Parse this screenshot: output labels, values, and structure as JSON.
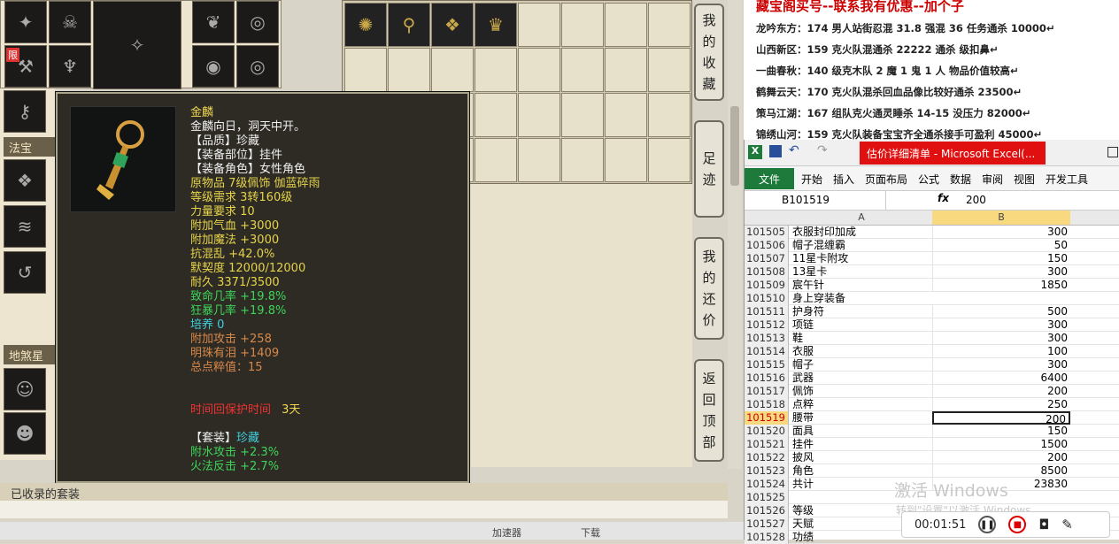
{
  "inventory": {
    "limit_badge": "限"
  },
  "sections": {
    "fabao": "法宝",
    "disha": "地煞星",
    "collected": "已收录的套装"
  },
  "tooltip": {
    "name": "金麟",
    "desc": "金麟向日，洞天中开。",
    "lines": [
      {
        "text": "【品质】珍藏",
        "color": "#f0f0f0"
      },
      {
        "text": "【装备部位】挂件",
        "color": "#f0f0f0"
      },
      {
        "text": "【装备角色】女性角色",
        "color": "#f0f0f0"
      },
      {
        "text": "原物品 7级佩饰 伽蓝碎雨",
        "color": "#e6d34a"
      },
      {
        "text": "等级需求 3转160级",
        "color": "#e6d34a"
      },
      {
        "text": "力量要求 10",
        "color": "#e6d34a"
      },
      {
        "text": "附加气血 +3000",
        "color": "#e6d34a"
      },
      {
        "text": "附加魔法 +3000",
        "color": "#e6d34a"
      },
      {
        "text": "抗混乱 +42.0%",
        "color": "#e6d34a"
      },
      {
        "text": "默契度 12000/12000",
        "color": "#e6d34a"
      },
      {
        "text": "耐久 3371/3500",
        "color": "#e6d34a"
      },
      {
        "text": "致命几率 +19.8%",
        "color": "#3ed45a"
      },
      {
        "text": "狂暴几率 +19.8%",
        "color": "#3ed45a"
      },
      {
        "text": "培养 0",
        "color": "#3fd0e0"
      },
      {
        "text": "附加攻击 +258",
        "color": "#d8884a"
      },
      {
        "text": "明珠有泪 +1409",
        "color": "#d8884a"
      },
      {
        "text": "总点粹值：15",
        "color": "#d8884a"
      }
    ],
    "protect_label": "时间回保护时间",
    "protect_value": "3天",
    "set_label": "【套装】",
    "set_name": "珍藏",
    "set_lines": [
      "附水攻击 +2.3%",
      "火法反击 +2.7%"
    ]
  },
  "side_buttons": [
    {
      "label": [
        "我",
        "的",
        "收",
        "藏"
      ]
    },
    {
      "label": [
        "足",
        "迹"
      ]
    },
    {
      "label": [
        "我",
        "的",
        "还",
        "价"
      ]
    },
    {
      "label": [
        "返",
        "回",
        "顶",
        "部"
      ]
    }
  ],
  "status": {
    "speed": "加速器",
    "download": "下载"
  },
  "doc": {
    "title": "藏宝阁买号--联系我有优惠--加个子",
    "lines": [
      "龙吟东方：174 男人站街忍混 31.8 强混 36 任务通杀 10000↵",
      "山西新区：159 克火队混通杀 22222 通杀 级扣鼻↵",
      "一曲春秋：140 级克木队 2 魔 1 鬼 1 人 物品价值较高↵",
      "鹤舞云天：170 克火队混杀回血品像比较好通杀 23500↵",
      "策马江湖：167 组队克火通灵睡杀 14-15 没压力 82000↵",
      "锦绣山河：159 克火队装备宝宝齐全通杀接手可盈利 45000↵"
    ]
  },
  "excel": {
    "window_title": "估价详细清单 - Microsoft Excel(...",
    "menu": [
      "文件",
      "开始",
      "插入",
      "页面布局",
      "公式",
      "数据",
      "审阅",
      "视图",
      "开发工具"
    ],
    "cell_ref": "B101519",
    "fx_value": "200",
    "col_a": "A",
    "col_b": "B",
    "rows": [
      {
        "n": "101505",
        "a": "衣服封印加成",
        "b": "300"
      },
      {
        "n": "101506",
        "a": "帽子混缠霸",
        "b": "50"
      },
      {
        "n": "101507",
        "a": "11星卡附攻",
        "b": "150"
      },
      {
        "n": "101508",
        "a": "13星卡",
        "b": "300"
      },
      {
        "n": "101509",
        "a": "宸午针",
        "b": "1850"
      },
      {
        "n": "101510",
        "a": "身上穿装备",
        "b": ""
      },
      {
        "n": "101511",
        "a": "护身符",
        "b": "500"
      },
      {
        "n": "101512",
        "a": "项链",
        "b": "300"
      },
      {
        "n": "101513",
        "a": "鞋",
        "b": "300"
      },
      {
        "n": "101514",
        "a": "衣服",
        "b": "100"
      },
      {
        "n": "101515",
        "a": "帽子",
        "b": "300"
      },
      {
        "n": "101516",
        "a": "武器",
        "b": "6400"
      },
      {
        "n": "101517",
        "a": "佩饰",
        "b": "200"
      },
      {
        "n": "101518",
        "a": "点粹",
        "b": "250"
      },
      {
        "n": "101519",
        "a": "腰带",
        "b": "200"
      },
      {
        "n": "101520",
        "a": "面具",
        "b": "150"
      },
      {
        "n": "101521",
        "a": "挂件",
        "b": "1500"
      },
      {
        "n": "101522",
        "a": "披风",
        "b": "200"
      },
      {
        "n": "101523",
        "a": "角色",
        "b": "8500"
      },
      {
        "n": "101524",
        "a": "共计",
        "b": "23830"
      },
      {
        "n": "101525",
        "a": "",
        "b": ""
      },
      {
        "n": "101526",
        "a": "等级",
        "b": ""
      },
      {
        "n": "101527",
        "a": "天赋",
        "b": ""
      },
      {
        "n": "101528",
        "a": "功绩",
        "b": ""
      }
    ],
    "selected_row": "101519"
  },
  "watermark": {
    "line1": "激活 Windows",
    "line2": "转到\"设置\"以激活 Windows。"
  },
  "recorder": {
    "time": "00:01:51"
  }
}
